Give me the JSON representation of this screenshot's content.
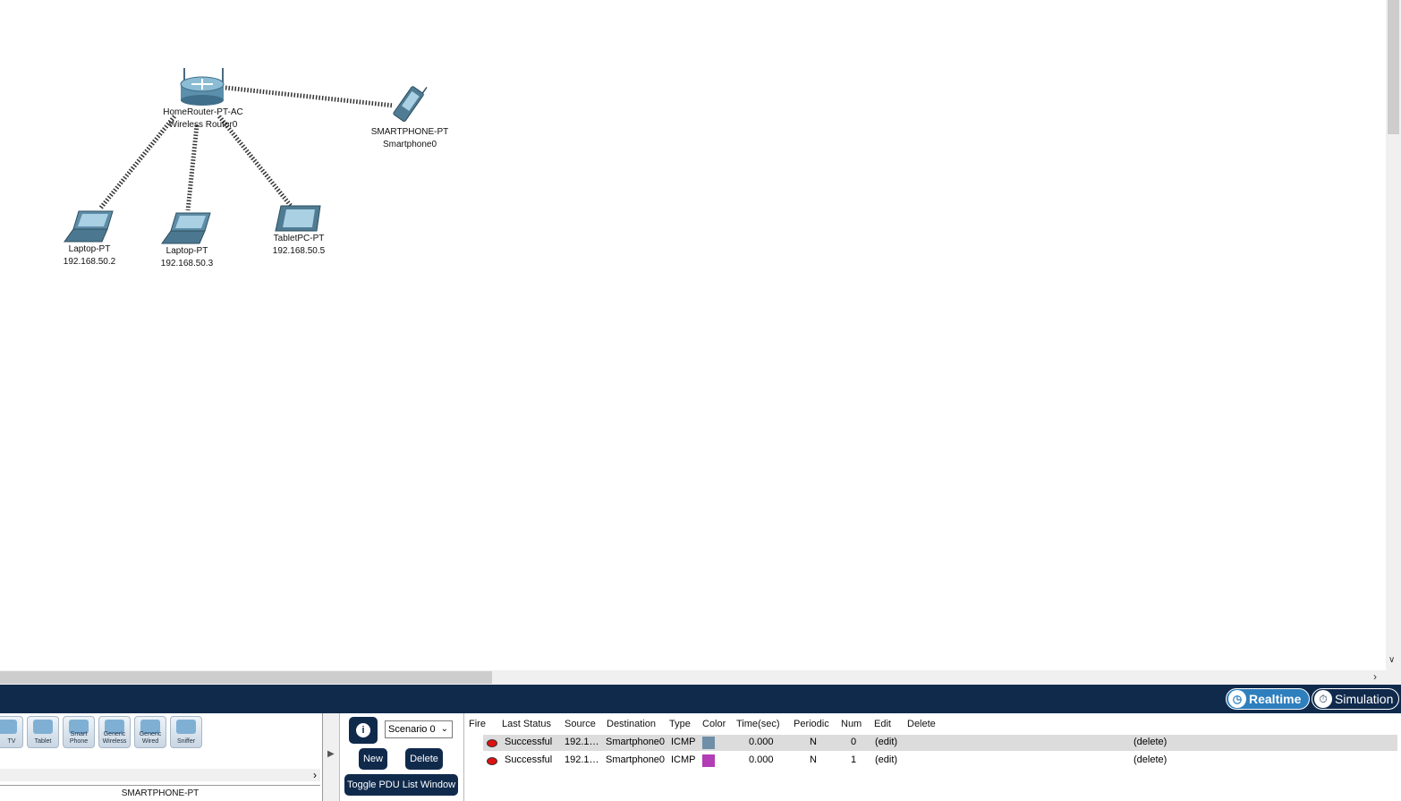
{
  "workspace": {
    "devices": {
      "router": {
        "line1": "HomeRouter-PT-AC",
        "line2": "Wireless Router0"
      },
      "smartphone": {
        "line1": "SMARTPHONE-PT",
        "line2": "Smartphone0"
      },
      "laptop1": {
        "line1": "Laptop-PT",
        "line2": "192.168.50.2"
      },
      "laptop2": {
        "line1": "Laptop-PT",
        "line2": "192.168.50.3"
      },
      "tablet": {
        "line1": "TabletPC-PT",
        "line2": "192.168.50.5"
      }
    }
  },
  "mode_bar": {
    "realtime_label": "Realtime",
    "simulation_label": "Simulation",
    "realtime_color": "#2e7fbd",
    "bar_color": "#102a4c"
  },
  "device_palette": {
    "tiles": [
      "TV",
      "Tablet",
      "Smart Phone",
      "Generic Wireless",
      "Generic Wired",
      "Sniffer"
    ],
    "selected_name": "SMARTPHONE-PT"
  },
  "scenario": {
    "selected": "Scenario 0",
    "new_label": "New",
    "delete_label": "Delete",
    "toggle_label": "Toggle PDU List Window"
  },
  "pdu_list": {
    "headers": [
      "Fire",
      "Last Status",
      "Source",
      "Destination",
      "Type",
      "Color",
      "Time(sec)",
      "Periodic",
      "Num",
      "Edit",
      "Delete"
    ],
    "rows": [
      {
        "status": "Successful",
        "source": "192.1…",
        "destination": "Smartphone0",
        "type": "ICMP",
        "color": "#6f8fa8",
        "time": "0.000",
        "periodic": "N",
        "num": "0",
        "edit": "(edit)",
        "delete": "(delete)"
      },
      {
        "status": "Successful",
        "source": "192.1…",
        "destination": "Smartphone0",
        "type": "ICMP",
        "color": "#b23db5",
        "time": "0.000",
        "periodic": "N",
        "num": "1",
        "edit": "(edit)",
        "delete": "(delete)"
      }
    ]
  }
}
